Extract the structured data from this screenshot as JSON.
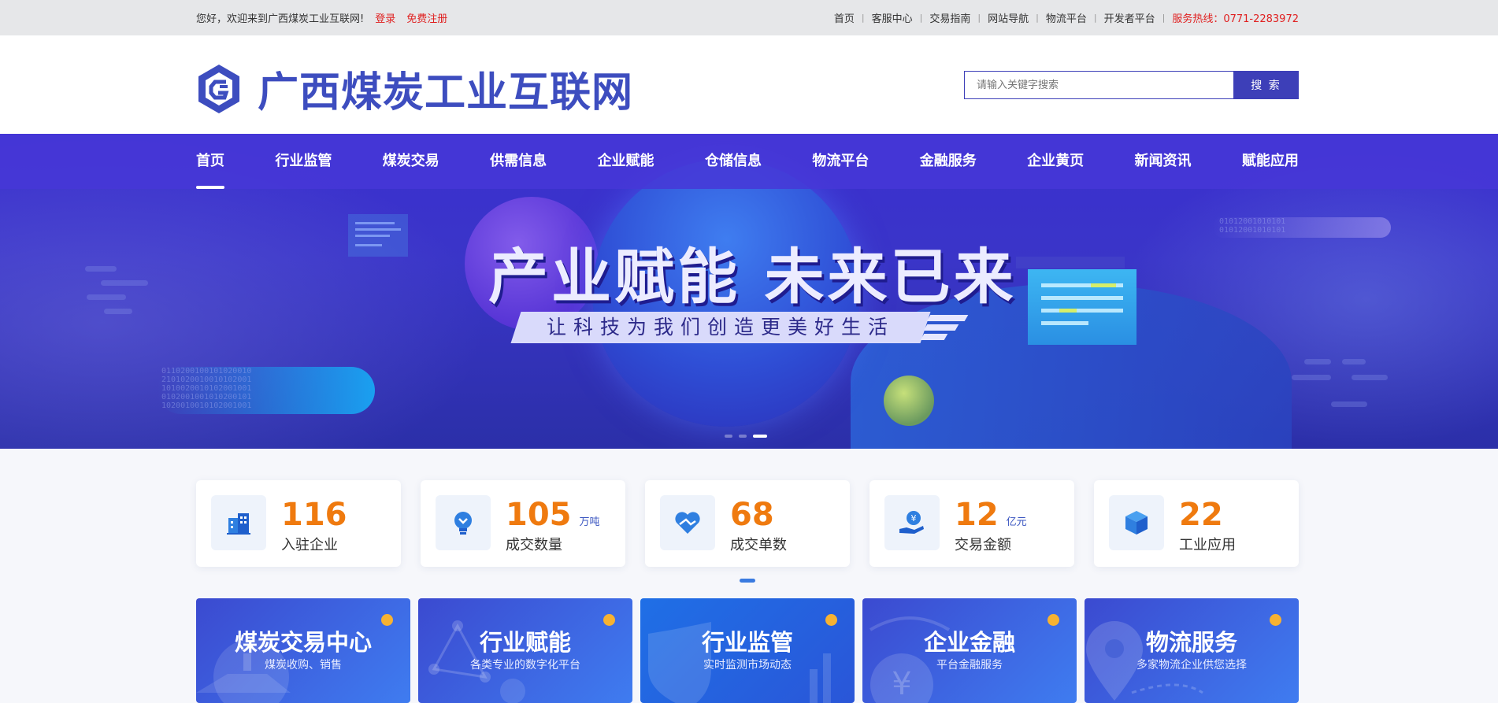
{
  "topbar": {
    "welcome": "您好，欢迎来到广西煤炭工业互联网!",
    "login": "登录",
    "register": "免费注册",
    "links": [
      "首页",
      "客服中心",
      "交易指南",
      "网站导航",
      "物流平台",
      "开发者平台"
    ],
    "hotline": "服务热线：0771-2283972"
  },
  "header": {
    "logo_text": "广西煤炭工业互联网",
    "search_placeholder": "请输入关键字搜索",
    "search_button": "搜 索"
  },
  "nav": {
    "items": [
      "首页",
      "行业监管",
      "煤炭交易",
      "供需信息",
      "企业赋能",
      "仓储信息",
      "物流平台",
      "金融服务",
      "企业黄页",
      "新闻资讯",
      "赋能应用"
    ],
    "active_index": 0
  },
  "banner": {
    "title": "产业赋能 未来已来",
    "subtitle": "让科技为我们创造更美好生活",
    "slides": 3,
    "active_slide": 2
  },
  "stats": [
    {
      "value": "116",
      "unit": "",
      "label": "入驻企业",
      "icon": "building-icon"
    },
    {
      "value": "105",
      "unit": "万吨",
      "label": "成交数量",
      "icon": "lightbulb-icon"
    },
    {
      "value": "68",
      "unit": "",
      "label": "成交单数",
      "icon": "handshake-heart-icon"
    },
    {
      "value": "12",
      "unit": "亿元",
      "label": "交易金额",
      "icon": "yuan-hand-icon"
    },
    {
      "value": "22",
      "unit": "",
      "label": "工业应用",
      "icon": "cube-icon"
    }
  ],
  "cards": [
    {
      "title": "煤炭交易中心",
      "subtitle": "煤炭收购、销售"
    },
    {
      "title": "行业赋能",
      "subtitle": "各类专业的数字化平台"
    },
    {
      "title": "行业监管",
      "subtitle": "实时监测市场动态"
    },
    {
      "title": "企业金融",
      "subtitle": "平台金融服务"
    },
    {
      "title": "物流服务",
      "subtitle": "多家物流企业供您选择"
    }
  ],
  "colors": {
    "brand": "#3d4dbf",
    "accent_orange": "#ef7a0f",
    "hotline_red": "#e02020"
  }
}
